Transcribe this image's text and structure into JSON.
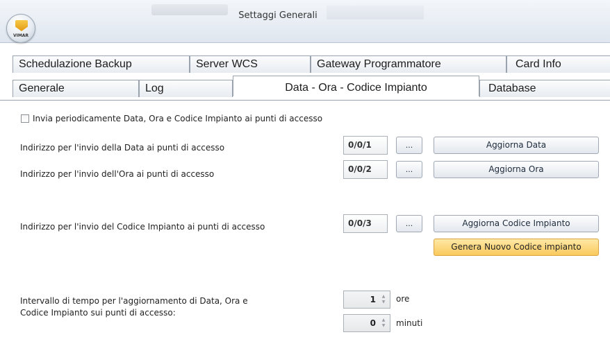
{
  "window": {
    "title": "Settaggi Generali",
    "logo_text": "VIMAR"
  },
  "tabs": {
    "row1": [
      "Schedulazione Backup",
      "Server WCS",
      "Gateway Programmatore",
      "Card Info"
    ],
    "row2": [
      "Generale",
      "Log",
      "Data - Ora - Codice Impianto",
      "Database"
    ],
    "active": "Data - Ora - Codice Impianto"
  },
  "content": {
    "periodic_checkbox": {
      "label": "Invia periodicamente Data, Ora e Codice Impianto ai punti di accesso",
      "checked": false
    },
    "date": {
      "label": "Indirizzo per l'invio della Data ai punti di accesso",
      "address": "0/0/1",
      "browse_label": "...",
      "update_label": "Aggiorna Data"
    },
    "time": {
      "label": "Indirizzo per l'invio dell'Ora ai punti di accesso",
      "address": "0/0/2",
      "browse_label": "...",
      "update_label": "Aggiorna Ora"
    },
    "code": {
      "label": "Indirizzo per l'invio del Codice Impianto ai punti di accesso",
      "address": "0/0/3",
      "browse_label": "...",
      "update_label": "Aggiorna Codice Impianto",
      "generate_label": "Genera Nuovo Codice impianto"
    },
    "interval": {
      "label_line1": "Intervallo di tempo per l'aggiornamento di Data, Ora e",
      "label_line2": "Codice Impianto sui punti di accesso:",
      "hours_value": "1",
      "hours_unit": "ore",
      "minutes_value": "0",
      "minutes_unit": "minuti"
    }
  },
  "colors": {
    "accent_orange": "#f9c95c",
    "tab_border": "#9aa3ad"
  }
}
